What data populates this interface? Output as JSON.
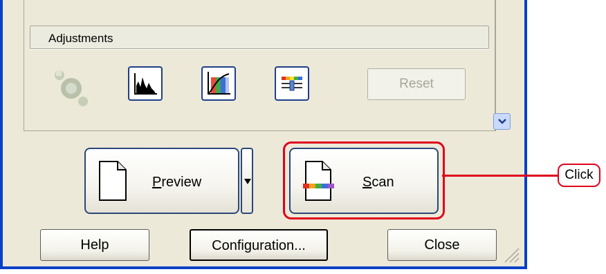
{
  "adjustments": {
    "title": "Adjustments",
    "icons": [
      "unsharp-mask-icon",
      "histogram-icon",
      "tone-curve-icon",
      "color-palette-icon"
    ],
    "reset_label": "Reset"
  },
  "buttons": {
    "preview": {
      "accel": "P",
      "rest": "review"
    },
    "scan": {
      "accel": "S",
      "rest": "can"
    },
    "help_label": "Help",
    "configuration_label": "Configuration...",
    "close_label": "Close"
  },
  "callout": {
    "label": "Click",
    "color": "#e0001c"
  },
  "colors": {
    "window_border": "#0a40c8",
    "face": "#ece9d8",
    "button_border": "#29477a"
  }
}
